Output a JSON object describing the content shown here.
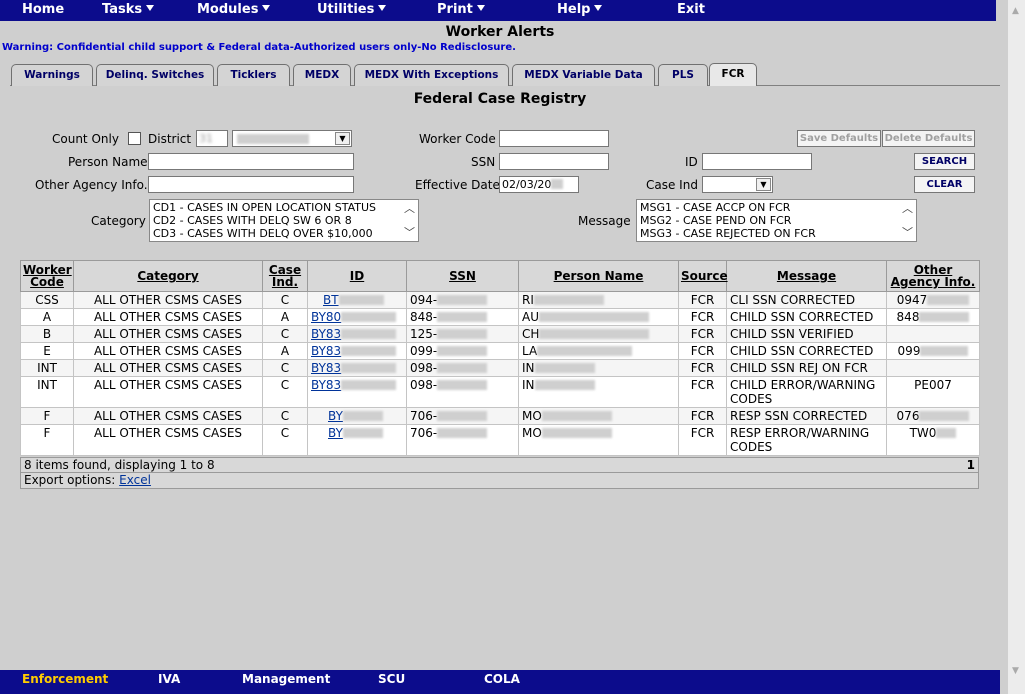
{
  "topnav": {
    "items": [
      {
        "label": "Home"
      },
      {
        "label": "Tasks"
      },
      {
        "label": "Modules"
      },
      {
        "label": "Utilities"
      },
      {
        "label": "Print"
      },
      {
        "label": "Help"
      },
      {
        "label": "Exit"
      }
    ]
  },
  "page_title": "Worker Alerts",
  "warning": "Warning: Confidential child support & Federal data-Authorized users only-No Redisclosure.",
  "tabs": [
    {
      "label": "Warnings"
    },
    {
      "label": "Delinq. Switches"
    },
    {
      "label": "Ticklers"
    },
    {
      "label": "MEDX"
    },
    {
      "label": "MEDX With Exceptions"
    },
    {
      "label": "MEDX Variable Data"
    },
    {
      "label": "PLS"
    },
    {
      "label": "FCR",
      "active": true
    }
  ],
  "section_title": "Federal Case Registry",
  "form": {
    "count_only_label": "Count Only",
    "district_label": "District",
    "district_code": "31",
    "worker_code_label": "Worker Code",
    "worker_code_value": "",
    "person_name_label": "Person Name",
    "person_name_value": "",
    "ssn_label": "SSN",
    "ssn_value": "",
    "id_label": "ID",
    "id_value": "",
    "other_agency_label": "Other Agency Info.",
    "other_agency_value": "",
    "effective_date_label": "Effective Date",
    "effective_date_value": "02/03/20",
    "case_ind_label": "Case Ind",
    "case_ind_value": "",
    "category_label": "Category",
    "category_options": [
      "CD1 - CASES IN OPEN LOCATION STATUS",
      "CD2 - CASES WITH DELQ SW 6 OR 8",
      "CD3 - CASES WITH DELQ OVER $10,000"
    ],
    "message_label": "Message",
    "message_options": [
      "MSG1 - CASE ACCP ON FCR",
      "MSG2 - CASE PEND ON FCR",
      "MSG3 - CASE REJECTED ON FCR"
    ],
    "save_defaults_label": "Save Defaults",
    "delete_defaults_label": "Delete Defaults",
    "search_label": "SEARCH",
    "clear_label": "CLEAR"
  },
  "table": {
    "headers": {
      "worker_code": "Worker Code",
      "category": "Category",
      "case_ind": "Case Ind.",
      "id": "ID",
      "ssn": "SSN",
      "person_name": "Person Name",
      "source": "Source",
      "message": "Message",
      "other_agency": "Other Agency Info."
    },
    "rows": [
      {
        "worker_code": "CSS",
        "category": "ALL OTHER CSMS CASES",
        "case_ind": "C",
        "id": "BT",
        "ssn": "094-",
        "person_name": "RI",
        "source": "FCR",
        "message": "CLI SSN CORRECTED",
        "other_agency": "0947"
      },
      {
        "worker_code": "A",
        "category": "ALL OTHER CSMS CASES",
        "case_ind": "A",
        "id": "BY80",
        "ssn": "848-",
        "person_name": "AU",
        "source": "FCR",
        "message": "CHILD SSN CORRECTED",
        "other_agency": "848"
      },
      {
        "worker_code": "B",
        "category": "ALL OTHER CSMS CASES",
        "case_ind": "C",
        "id": "BY83",
        "ssn": "125-",
        "person_name": "CH",
        "source": "FCR",
        "message": "CHILD SSN VERIFIED",
        "other_agency": ""
      },
      {
        "worker_code": "E",
        "category": "ALL OTHER CSMS CASES",
        "case_ind": "A",
        "id": "BY83",
        "ssn": "099-",
        "person_name": "LA",
        "source": "FCR",
        "message": "CHILD SSN CORRECTED",
        "other_agency": "099"
      },
      {
        "worker_code": "INT",
        "category": "ALL OTHER CSMS CASES",
        "case_ind": "C",
        "id": "BY83",
        "ssn": "098-",
        "person_name": "IN",
        "source": "FCR",
        "message": "CHILD SSN REJ ON FCR",
        "other_agency": ""
      },
      {
        "worker_code": "INT",
        "category": "ALL OTHER CSMS CASES",
        "case_ind": "C",
        "id": "BY83",
        "ssn": "098-",
        "person_name": "IN",
        "source": "FCR",
        "message": "CHILD ERROR/WARNING CODES",
        "other_agency": "PE007"
      },
      {
        "worker_code": "F",
        "category": "ALL OTHER CSMS CASES",
        "case_ind": "C",
        "id": "BY",
        "ssn": "706-",
        "person_name": "MO",
        "source": "FCR",
        "message": "RESP SSN CORRECTED",
        "other_agency": "076"
      },
      {
        "worker_code": "F",
        "category": "ALL OTHER CSMS CASES",
        "case_ind": "C",
        "id": "BY",
        "ssn": "706-",
        "person_name": "MO",
        "source": "FCR",
        "message": "RESP ERROR/WARNING CODES",
        "other_agency": "TW0"
      }
    ],
    "footer_text": "8 items found, displaying 1 to 8",
    "page_number": "1",
    "export_label": "Export options:",
    "export_link": "Excel"
  },
  "bottomnav": {
    "items": [
      {
        "label": "Enforcement",
        "active": true
      },
      {
        "label": "IVA"
      },
      {
        "label": "Management"
      },
      {
        "label": "SCU"
      },
      {
        "label": "COLA"
      }
    ]
  },
  "colors": {
    "nav_bg": "#0c0c8c",
    "link": "#003399",
    "warning": "#0000cc",
    "active_bottom": "#ffcc00"
  }
}
